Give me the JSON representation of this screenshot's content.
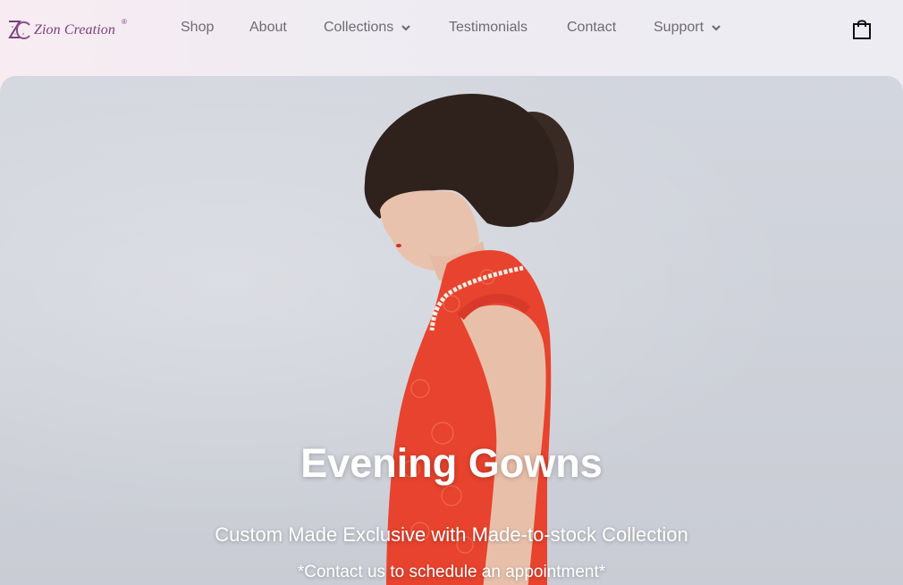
{
  "brand": {
    "name": "Zion Creation",
    "registered": "®",
    "monogram": "ZC",
    "color": "#7a3f7a"
  },
  "nav": {
    "items": [
      {
        "label": "Shop",
        "has_dropdown": false
      },
      {
        "label": "About",
        "has_dropdown": false
      },
      {
        "label": "Collections",
        "has_dropdown": true,
        "icon": "chevron-down-icon"
      },
      {
        "label": "Testimonials",
        "has_dropdown": false
      },
      {
        "label": "Contact",
        "has_dropdown": false
      },
      {
        "label": "Support",
        "has_dropdown": true,
        "icon": "chevron-down-icon"
      }
    ],
    "text_color": "#6f6b72"
  },
  "cart": {
    "icon": "shopping-bag-icon"
  },
  "hero": {
    "title": "Evening Gowns",
    "subtitle": "Custom Made Exclusive with Made-to-stock Collection",
    "note": "*Contact us to schedule an appointment*",
    "image": "woman-in-red-lace-cheongsam-photo",
    "dress_color": "#e8432e"
  }
}
